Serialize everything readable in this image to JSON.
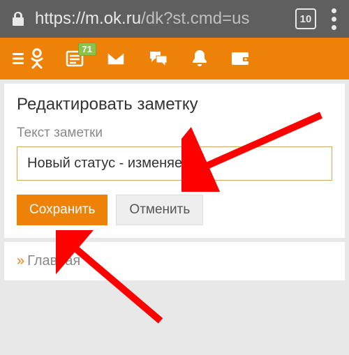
{
  "browser": {
    "url_prefix": "https://",
    "url_host": "m.ok.ru",
    "url_path": "/dk?st.cmd=us",
    "tab_count": "10"
  },
  "nav": {
    "message_badge": "71"
  },
  "editor": {
    "heading": "Редактировать заметку",
    "label": "Текст заметки",
    "value": "Новый статус - изменяем",
    "save": "Сохранить",
    "cancel": "Отменить"
  },
  "footer": {
    "home": "Главная"
  }
}
